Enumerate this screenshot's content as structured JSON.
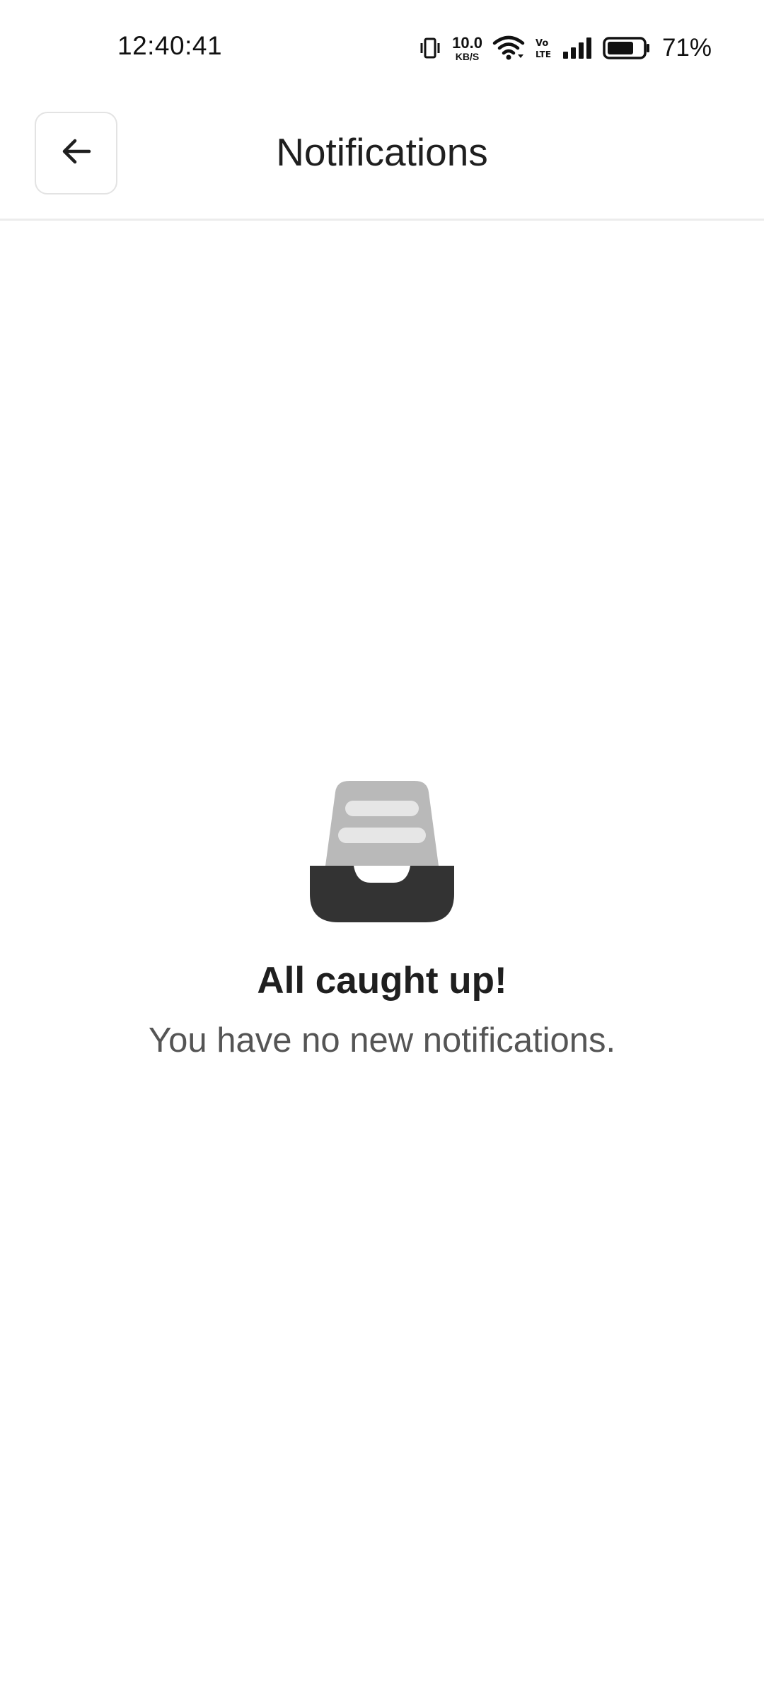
{
  "status_bar": {
    "time": "12:40:41",
    "net_speed_value": "10.0",
    "net_speed_unit": "KB/S",
    "battery_percent": "71%",
    "icons": [
      "vibrate-icon",
      "wifi-icon",
      "volte-icon",
      "signal-icon",
      "battery-icon"
    ]
  },
  "header": {
    "title": "Notifications",
    "back_icon": "arrow-left-icon"
  },
  "empty_state": {
    "icon": "inbox-icon",
    "title": "All caught up!",
    "subtitle": "You have no new notifications."
  },
  "colors": {
    "text_primary": "#1f1f1f",
    "text_secondary": "#555555",
    "inbox_tray": "#333333",
    "inbox_back": "#b9b9b9",
    "inbox_lines": "#e6e6e6"
  }
}
